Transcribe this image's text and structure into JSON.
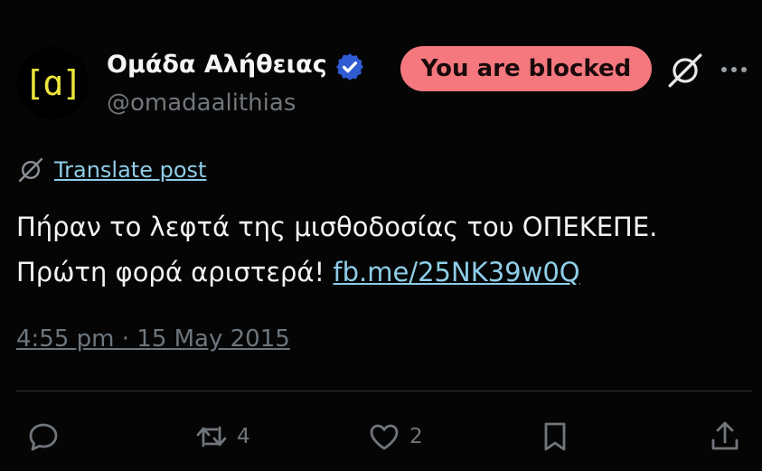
{
  "account": {
    "avatar_text": "[ɑ]",
    "display_name": "Ομάδα Αλήθειας",
    "handle": "@omadaalithias",
    "verified": true
  },
  "header": {
    "blocked_label": "You are blocked"
  },
  "translate": {
    "label": "Translate post"
  },
  "tweet": {
    "text_line1": "Πήραν το λεφτά της μισθοδοσίας του ΟΠΕΚΕΠΕ.",
    "text_line2": "Πρώτη φορά αριστερά! ",
    "link": "fb.me/25NK39w0Q",
    "timestamp": "4:55 pm · 15 May 2015"
  },
  "actions": {
    "replies": "",
    "reposts": "4",
    "likes": "2"
  },
  "colors": {
    "background": "#050505",
    "blocked_button": "#f4787e",
    "link": "#8ecde8",
    "verified_badge": "#2f5bd3",
    "avatar_text": "#ece43c"
  },
  "icons": [
    "verified-icon",
    "grok-icon",
    "more-icon",
    "translate-icon",
    "reply-icon",
    "repost-icon",
    "like-icon",
    "bookmark-icon",
    "share-icon"
  ]
}
